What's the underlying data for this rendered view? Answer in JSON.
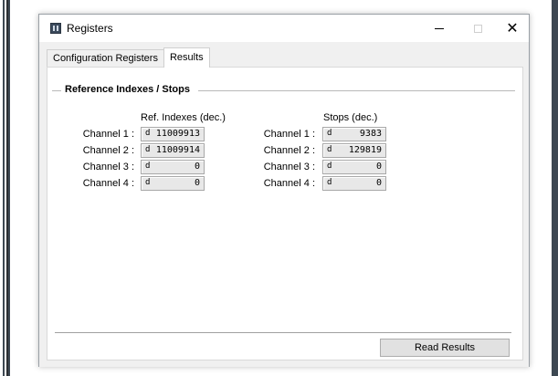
{
  "window": {
    "title": "Registers"
  },
  "tabs": [
    {
      "label": "Configuration Registers"
    },
    {
      "label": "Results"
    }
  ],
  "group": {
    "title": "Reference Indexes / Stops"
  },
  "ref_indexes": {
    "header": "Ref. Indexes (dec.)",
    "rows": [
      {
        "label": "Channel 1 :",
        "format": "d",
        "value": "11009913"
      },
      {
        "label": "Channel 2 :",
        "format": "d",
        "value": "11009914"
      },
      {
        "label": "Channel 3 :",
        "format": "d",
        "value": "0"
      },
      {
        "label": "Channel 4 :",
        "format": "d",
        "value": "0"
      }
    ]
  },
  "stops": {
    "header": "Stops (dec.)",
    "rows": [
      {
        "label": "Channel 1 :",
        "format": "d",
        "value": "9383"
      },
      {
        "label": "Channel 2 :",
        "format": "d",
        "value": "129819"
      },
      {
        "label": "Channel 3 :",
        "format": "d",
        "value": "0"
      },
      {
        "label": "Channel 4 :",
        "format": "d",
        "value": "0"
      }
    ]
  },
  "actions": {
    "read_results_label": "Read Results"
  }
}
